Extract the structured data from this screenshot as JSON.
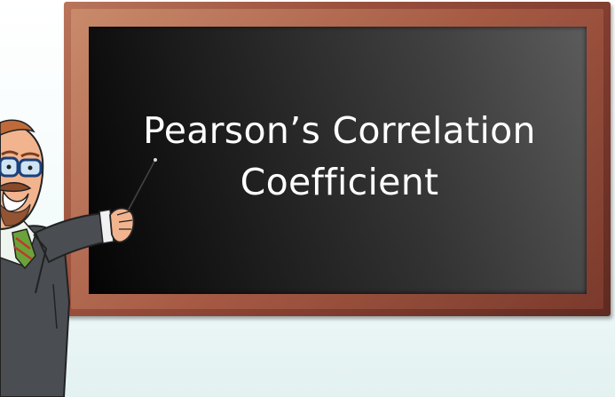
{
  "slide": {
    "title_line1": "Pearson’s Correlation",
    "title_line2": "Coefficient"
  },
  "colors": {
    "frame": "#8b4433",
    "board": "#262626",
    "title_text": "#ffffff",
    "suit": "#4a4a4a",
    "tie": "#6aa33a"
  },
  "icons": {
    "teacher": "teacher-pointing-icon",
    "pointer": "pointer-stick-icon"
  }
}
